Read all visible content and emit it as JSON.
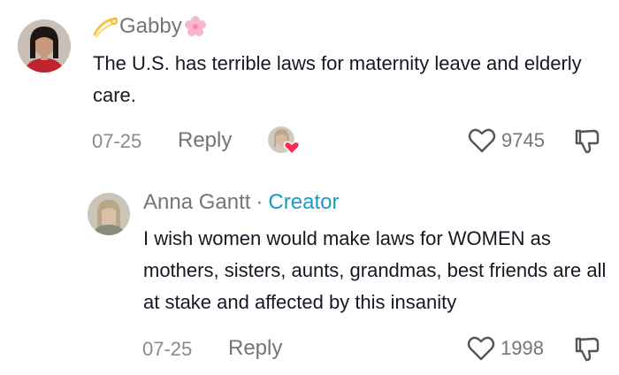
{
  "comments": [
    {
      "username": "Gabby",
      "text": "The U.S. has terrible laws for maternity leave and elderly care.",
      "date": "07-25",
      "reply_label": "Reply",
      "likes": "9745"
    },
    {
      "username": "Anna Gantt",
      "separator": "·",
      "creator_label": "Creator",
      "text": "I wish women would make laws for WOMEN as mothers, sisters, aunts, grandmas, best friends are all at stake and affected by this insanity",
      "date": "07-25",
      "reply_label": "Reply",
      "likes": "1998"
    }
  ],
  "colors": {
    "creator": "#1a9bc4",
    "heart_badge": "#fe2c55",
    "muted": "#757575",
    "text": "#161823"
  },
  "icons": {
    "like": "heart-outline-icon",
    "dislike": "thumbs-down-icon",
    "username_prefix": "comet-emoji-icon",
    "username_suffix": "cherry-blossom-emoji-icon"
  }
}
